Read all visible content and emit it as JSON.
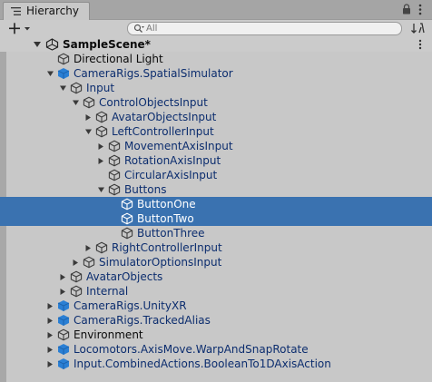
{
  "window": {
    "tab_label": "Hierarchy",
    "tab_icon": "list-icon",
    "lock_icon": "lock-icon",
    "menu_icon": "kebab-menu-icon"
  },
  "toolbar": {
    "add_icon": "plus-dropdown-icon",
    "search_placeholder": "All",
    "search_icon": "search-icon",
    "sort_icon": "sort-icon"
  },
  "scene": {
    "name": "SampleScene*",
    "icon": "unity-scene-icon",
    "expanded": true
  },
  "colors": {
    "selection": "#3a72b0",
    "prefab_text": "#0c2d6e",
    "prefab_icon": "#2a7fd4"
  },
  "tree": [
    {
      "label": "Directional Light",
      "level": 0,
      "arrow": "none",
      "icon": "gameobject-icon",
      "prefab": false,
      "selected": false
    },
    {
      "label": "CameraRigs.SpatialSimulator",
      "level": 0,
      "arrow": "expanded",
      "icon": "prefab-icon",
      "prefab": true,
      "selected": false
    },
    {
      "label": "Input",
      "level": 1,
      "arrow": "expanded",
      "icon": "gameobject-icon",
      "prefab": true,
      "selected": false
    },
    {
      "label": "ControlObjectsInput",
      "level": 2,
      "arrow": "expanded",
      "icon": "gameobject-icon",
      "prefab": true,
      "selected": false
    },
    {
      "label": "AvatarObjectsInput",
      "level": 3,
      "arrow": "collapsed",
      "icon": "gameobject-icon",
      "prefab": true,
      "selected": false
    },
    {
      "label": "LeftControllerInput",
      "level": 3,
      "arrow": "expanded",
      "icon": "gameobject-icon",
      "prefab": true,
      "selected": false
    },
    {
      "label": "MovementAxisInput",
      "level": 4,
      "arrow": "collapsed",
      "icon": "gameobject-icon",
      "prefab": true,
      "selected": false
    },
    {
      "label": "RotationAxisInput",
      "level": 4,
      "arrow": "collapsed",
      "icon": "gameobject-icon",
      "prefab": true,
      "selected": false
    },
    {
      "label": "CircularAxisInput",
      "level": 4,
      "arrow": "none",
      "icon": "gameobject-icon",
      "prefab": true,
      "selected": false
    },
    {
      "label": "Buttons",
      "level": 4,
      "arrow": "expanded",
      "icon": "gameobject-icon",
      "prefab": true,
      "selected": false
    },
    {
      "label": "ButtonOne",
      "level": 5,
      "arrow": "none",
      "icon": "gameobject-icon",
      "prefab": true,
      "selected": true
    },
    {
      "label": "ButtonTwo",
      "level": 5,
      "arrow": "none",
      "icon": "gameobject-icon",
      "prefab": true,
      "selected": true
    },
    {
      "label": "ButtonThree",
      "level": 5,
      "arrow": "none",
      "icon": "gameobject-icon",
      "prefab": true,
      "selected": false
    },
    {
      "label": "RightControllerInput",
      "level": 3,
      "arrow": "collapsed",
      "icon": "gameobject-icon",
      "prefab": true,
      "selected": false
    },
    {
      "label": "SimulatorOptionsInput",
      "level": 2,
      "arrow": "collapsed",
      "icon": "gameobject-icon",
      "prefab": true,
      "selected": false
    },
    {
      "label": "AvatarObjects",
      "level": 1,
      "arrow": "collapsed",
      "icon": "gameobject-icon",
      "prefab": true,
      "selected": false
    },
    {
      "label": "Internal",
      "level": 1,
      "arrow": "collapsed",
      "icon": "gameobject-icon",
      "prefab": true,
      "selected": false
    },
    {
      "label": "CameraRigs.UnityXR",
      "level": 0,
      "arrow": "collapsed",
      "icon": "prefab-icon",
      "prefab": true,
      "selected": false
    },
    {
      "label": "CameraRigs.TrackedAlias",
      "level": 0,
      "arrow": "collapsed",
      "icon": "prefab-icon",
      "prefab": true,
      "selected": false
    },
    {
      "label": "Environment",
      "level": 0,
      "arrow": "collapsed",
      "icon": "gameobject-icon",
      "prefab": false,
      "selected": false
    },
    {
      "label": "Locomotors.AxisMove.WarpAndSnapRotate",
      "level": 0,
      "arrow": "collapsed",
      "icon": "prefab-icon",
      "prefab": true,
      "selected": false
    },
    {
      "label": "Input.CombinedActions.BooleanTo1DAxisAction",
      "level": 0,
      "arrow": "collapsed",
      "icon": "prefab-icon",
      "prefab": true,
      "selected": false
    }
  ]
}
